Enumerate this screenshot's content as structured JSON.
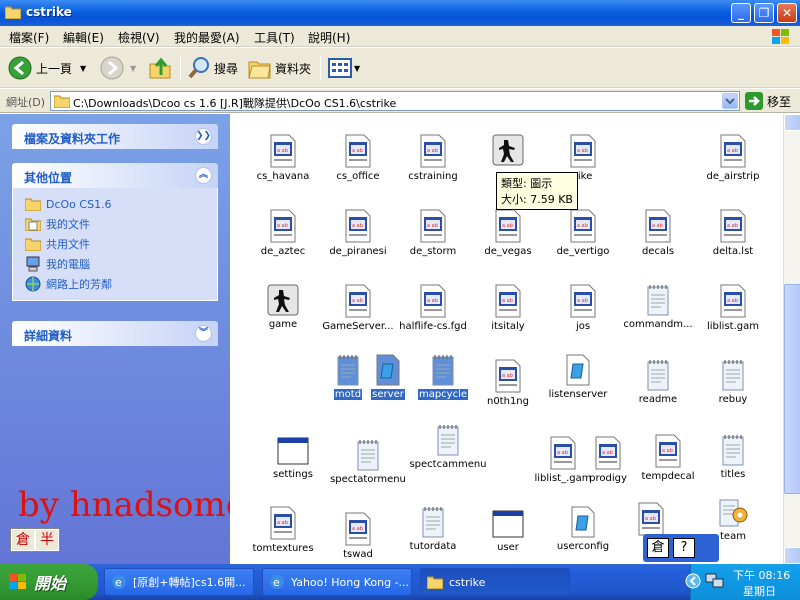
{
  "window": {
    "title": "cstrike"
  },
  "menu": [
    "檔案(F)",
    "編輯(E)",
    "檢視(V)",
    "我的最愛(A)",
    "工具(T)",
    "說明(H)"
  ],
  "toolbar": {
    "back": "上一頁",
    "search": "搜尋",
    "folders": "資料夾"
  },
  "address": {
    "label": "網址(D)",
    "path": "C:\\Downloads\\Dcoo cs 1.6 [J.R]戰隊提供\\DcOo CS1.6\\cstrike",
    "go": "移至"
  },
  "sidebar": {
    "tasks_title": "檔案及資料夾工作",
    "other_title": "其他位置",
    "other_places": [
      "DcOo CS1.6",
      "我的文件",
      "共用文件",
      "我的電腦",
      "網路上的芳鄰"
    ],
    "details_title": "詳細資料"
  },
  "overlay": {
    "text": "by hnadsome",
    "ime": [
      "倉",
      "半"
    ]
  },
  "tooltip": {
    "type": "類型: 圖示",
    "size": "大小: 7.59 KB"
  },
  "files": [
    {
      "name": "cs_havana",
      "icon": "map-file-icon"
    },
    {
      "name": "cs_office",
      "icon": "map-file-icon"
    },
    {
      "name": "cstraining",
      "icon": "map-file-icon"
    },
    {
      "name": "",
      "icon": "cs-logo-icon"
    },
    {
      "name": "rike",
      "icon": "map-file-icon"
    },
    {
      "name": "de_airstrip",
      "icon": "map-file-icon"
    },
    {
      "name": "de_aztec",
      "icon": "map-file-icon"
    },
    {
      "name": "de_piranesi",
      "icon": "map-file-icon"
    },
    {
      "name": "de_storm",
      "icon": "map-file-icon"
    },
    {
      "name": "de_vegas",
      "icon": "map-file-icon"
    },
    {
      "name": "de_vertigo",
      "icon": "map-file-icon"
    },
    {
      "name": "decals",
      "icon": "map-file-icon"
    },
    {
      "name": "delta.lst",
      "icon": "map-file-icon"
    },
    {
      "name": "game",
      "icon": "cs-logo-icon"
    },
    {
      "name": "GameServer...",
      "icon": "map-file-icon"
    },
    {
      "name": "halflife-cs.fgd",
      "icon": "map-file-icon"
    },
    {
      "name": "itsitaly",
      "icon": "map-file-icon"
    },
    {
      "name": "jos",
      "icon": "map-file-icon"
    },
    {
      "name": "commandm...",
      "icon": "text-file-icon"
    },
    {
      "name": "liblist.gam",
      "icon": "map-file-icon"
    },
    {
      "name": "motd",
      "icon": "text-file-icon",
      "selected": true
    },
    {
      "name": "server",
      "icon": "blue-file-icon",
      "selected": true
    },
    {
      "name": "mapcycle",
      "icon": "text-file-icon",
      "selected": true
    },
    {
      "name": "n0th1ng",
      "icon": "map-file-icon"
    },
    {
      "name": "listenserver",
      "icon": "blue-file-icon"
    },
    {
      "name": "readme",
      "icon": "text-file-icon"
    },
    {
      "name": "rebuy",
      "icon": "text-file-icon"
    },
    {
      "name": "settings",
      "icon": "window-file-icon"
    },
    {
      "name": "spectatormenu",
      "icon": "text-file-icon"
    },
    {
      "name": "spectcammenu",
      "icon": "text-file-icon"
    },
    {
      "name": "liblist_.gam",
      "icon": "map-file-icon"
    },
    {
      "name": "prodigy",
      "icon": "map-file-icon"
    },
    {
      "name": "tempdecal",
      "icon": "map-file-icon"
    },
    {
      "name": "titles",
      "icon": "text-file-icon"
    },
    {
      "name": "tomtextures",
      "icon": "map-file-icon"
    },
    {
      "name": "tswad",
      "icon": "map-file-icon"
    },
    {
      "name": "tutordata",
      "icon": "text-file-icon"
    },
    {
      "name": "user",
      "icon": "window-file-icon"
    },
    {
      "name": "userconfig",
      "icon": "blue-file-icon"
    },
    {
      "name": "",
      "icon": "map-file-icon"
    },
    {
      "name": "team",
      "icon": "notepad-gear-icon"
    }
  ],
  "imebar": [
    "倉",
    "?"
  ],
  "taskbar": {
    "start": "開始",
    "tasks": [
      "[原創+轉帖]cs1.6開...",
      "Yahoo! Hong Kong -...",
      "cstrike"
    ],
    "clock_time": "下午 08:16",
    "clock_day": "星期日"
  },
  "colors": {
    "selection": "#316ac5",
    "taskpane": "#7ba2e7",
    "overlay_text": "#dd1111"
  }
}
